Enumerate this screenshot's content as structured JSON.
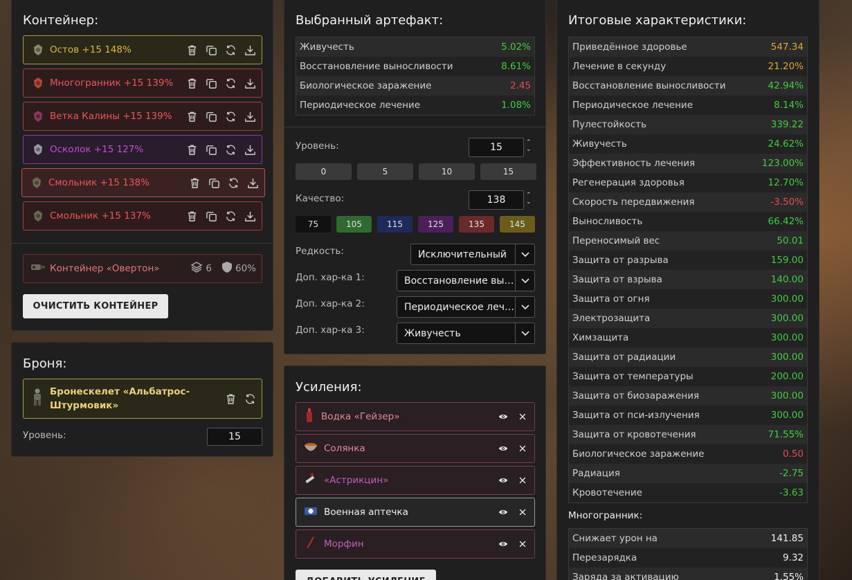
{
  "container": {
    "title": "Контейнер:",
    "artifacts": [
      {
        "label": "Остов +15 148%",
        "color": "#d8b845",
        "border": "#b09a3a",
        "bg": "#2a2818",
        "icon": "ostov-artifact-icon"
      },
      {
        "label": "Многогранник +15 139%",
        "color": "#ee5555",
        "border": "#a04040",
        "bg": "#2e1c1c",
        "icon": "mnogogrannik-artifact-icon"
      },
      {
        "label": "Ветка Калины +15 139%",
        "color": "#ee5555",
        "border": "#a04040",
        "bg": "#2e1c1c",
        "icon": "vetka-kaliny-artifact-icon"
      },
      {
        "label": "Осколок +15 127%",
        "color": "#c050d0",
        "border": "#8a3a9a",
        "bg": "#291c2c",
        "icon": "oskolok-artifact-icon"
      },
      {
        "label": "Смольник +15 138%",
        "color": "#ee5555",
        "border": "#c05050",
        "bg": "#3a2222",
        "icon": "smolnik-artifact-icon"
      },
      {
        "label": "Смольник +15 137%",
        "color": "#ee5555",
        "border": "#a04040",
        "bg": "#2e1c1c",
        "icon": "smolnik-artifact-icon"
      }
    ],
    "container_item": {
      "label": "Контейнер «Овертон»",
      "slots": "6",
      "protection": "60%"
    },
    "clear_button": "ОЧИСТИТЬ КОНТЕЙНЕР"
  },
  "armor": {
    "title": "Броня:",
    "name_line1": "Бронескелет «Альбатрос-",
    "name_line2": "Штурмовик»",
    "level_label": "Уровень:",
    "level_value": "15"
  },
  "artifact": {
    "title": "Выбранный артефакт:",
    "stats": [
      {
        "name": "Живучесть",
        "value": "5.02%",
        "tone": "green"
      },
      {
        "name": "Восстановление выносливости",
        "value": "8.61%",
        "tone": "green"
      },
      {
        "name": "Биологическое заражение",
        "value": "2.45",
        "tone": "red"
      },
      {
        "name": "Периодическое лечение",
        "value": "1.08%",
        "tone": "green"
      }
    ],
    "level_label": "Уровень:",
    "level_value": "15",
    "level_presets": [
      "0",
      "5",
      "10",
      "15"
    ],
    "quality_label": "Качество:",
    "quality_value": "138",
    "quality_presets": [
      {
        "label": "75",
        "bg": "#111111"
      },
      {
        "label": "105",
        "bg": "#2f6a30"
      },
      {
        "label": "115",
        "bg": "#1d2a5a"
      },
      {
        "label": "125",
        "bg": "#4c1f5a"
      },
      {
        "label": "135",
        "bg": "#6a2a2a"
      },
      {
        "label": "145",
        "bg": "#6a5d1c"
      }
    ],
    "rarity_label": "Редкость:",
    "rarity_value": "Исключительный",
    "extra1_label": "Доп. хар-ка 1:",
    "extra1_value": "Восстановление выносливости",
    "extra2_label": "Доп. хар-ка 2:",
    "extra2_value": "Периодическое лечение",
    "extra3_label": "Доп. хар-ка 3:",
    "extra3_value": "Живучесть"
  },
  "boosts": {
    "title": "Усиления:",
    "items": [
      {
        "label": "Водка «Гейзер»",
        "color": "#e08a9a",
        "icon": "vodka-bottle-icon"
      },
      {
        "label": "Солянка",
        "color": "#e08a9a",
        "icon": "soup-bowl-icon"
      },
      {
        "label": "«Астрикцин»",
        "color": "#c060c0",
        "icon": "syringe-icon"
      },
      {
        "label": "Военная аптечка",
        "color": "#f0f0f0",
        "icon": "medkit-icon"
      },
      {
        "label": "Морфин",
        "color": "#c060c0",
        "icon": "morphine-syringe-icon"
      }
    ],
    "add_button": "ДОБАВИТЬ УСИЛЕНИЕ"
  },
  "totals": {
    "title": "Итоговые характеристики:",
    "stats": [
      {
        "name": "Приведённое здоровье",
        "value": "547.34",
        "tone": "yellow"
      },
      {
        "name": "Лечение в секунду",
        "value": "21.20%",
        "tone": "yellow"
      },
      {
        "name": "Восстановление выносливости",
        "value": "42.94%",
        "tone": "green"
      },
      {
        "name": "Периодическое лечение",
        "value": "8.14%",
        "tone": "green"
      },
      {
        "name": "Пулестойкость",
        "value": "339.22",
        "tone": "green"
      },
      {
        "name": "Живучесть",
        "value": "24.62%",
        "tone": "green"
      },
      {
        "name": "Эффективность лечения",
        "value": "123.00%",
        "tone": "green"
      },
      {
        "name": "Регенерация здоровья",
        "value": "12.70%",
        "tone": "green"
      },
      {
        "name": "Скорость передвижения",
        "value": "-3.50%",
        "tone": "red"
      },
      {
        "name": "Выносливость",
        "value": "66.42%",
        "tone": "green"
      },
      {
        "name": "Переносимый вес",
        "value": "50.01",
        "tone": "green"
      },
      {
        "name": "Защита от разрыва",
        "value": "159.00",
        "tone": "green"
      },
      {
        "name": "Защита от взрыва",
        "value": "140.00",
        "tone": "green"
      },
      {
        "name": "Защита от огня",
        "value": "300.00",
        "tone": "green"
      },
      {
        "name": "Электрозащита",
        "value": "300.00",
        "tone": "green"
      },
      {
        "name": "Химзащита",
        "value": "300.00",
        "tone": "green"
      },
      {
        "name": "Защита от радиации",
        "value": "300.00",
        "tone": "green"
      },
      {
        "name": "Защита от температуры",
        "value": "200.00",
        "tone": "green"
      },
      {
        "name": "Защита от биозаражения",
        "value": "300.00",
        "tone": "green"
      },
      {
        "name": "Защита от пси-излучения",
        "value": "300.00",
        "tone": "green"
      },
      {
        "name": "Защита от кровотечения",
        "value": "71.55%",
        "tone": "green"
      },
      {
        "name": "Биологическое заражение",
        "value": "0.50",
        "tone": "red"
      },
      {
        "name": "Радиация",
        "value": "-2.75",
        "tone": "green"
      },
      {
        "name": "Кровотечение",
        "value": "-3.63",
        "tone": "green"
      }
    ],
    "sub_title": "Многогранник:",
    "sub_stats": [
      {
        "name": "Снижает урон на",
        "value": "141.85",
        "tone": "white"
      },
      {
        "name": "Перезарядка",
        "value": "9.32",
        "tone": "white"
      },
      {
        "name": "Заряда за активацию",
        "value": "1.55%",
        "tone": "white"
      }
    ]
  }
}
